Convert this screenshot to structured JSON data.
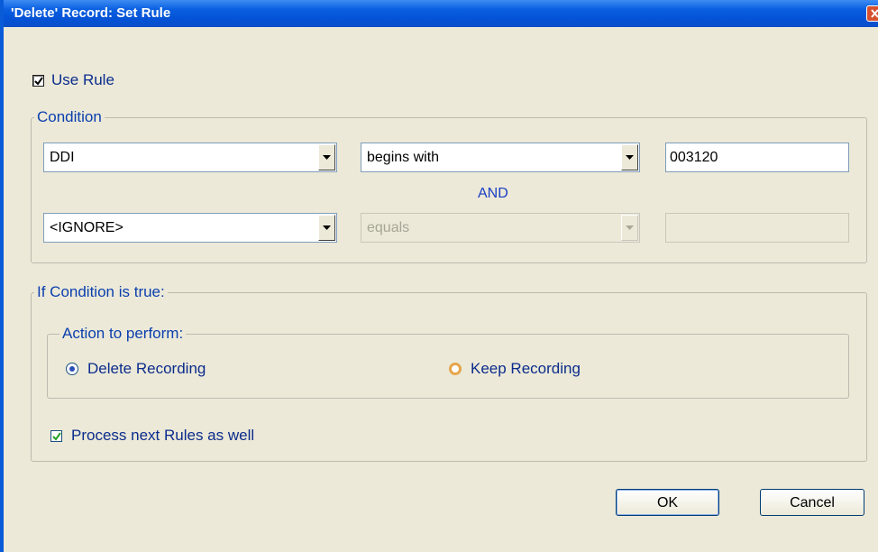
{
  "window": {
    "title": "'Delete' Record: Set Rule"
  },
  "use_rule": {
    "label": "Use Rule",
    "checked": true
  },
  "condition": {
    "group_label": "Condition",
    "row1": {
      "field": "DDI",
      "operator": "begins with",
      "value": "003120"
    },
    "connector": "AND",
    "row2": {
      "field": "<IGNORE>",
      "operator": "equals",
      "value": ""
    }
  },
  "if_true": {
    "group_label": "If Condition is true:",
    "action": {
      "group_label": "Action to perform:",
      "options": [
        {
          "label": "Delete Recording",
          "selected": true
        },
        {
          "label": "Keep Recording",
          "selected": false
        }
      ]
    },
    "process_next": {
      "label": "Process next Rules as well",
      "checked": true
    }
  },
  "buttons": {
    "ok": "OK",
    "cancel": "Cancel"
  },
  "colors": {
    "titlebar": "#0a5fe0",
    "label_text": "#0b2c8c",
    "dialog_bg": "#ece9d8"
  }
}
